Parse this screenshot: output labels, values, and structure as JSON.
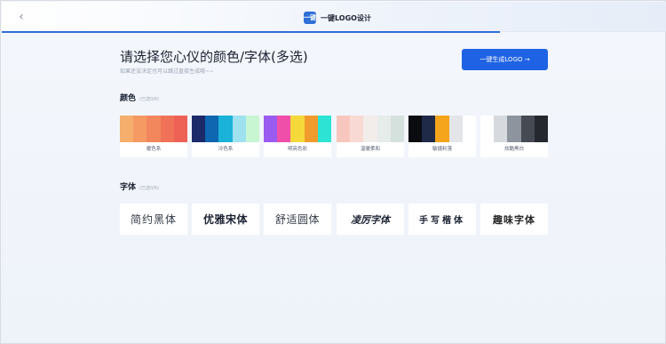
{
  "header": {
    "back_icon": "chevron-left-icon",
    "brand_logo_text": "一键",
    "brand_title": "一键LOGO设计",
    "progress_fraction": 0.75
  },
  "main": {
    "title": "请选择您心仪的颜色/字体(多选)",
    "subtitle": "如果还没决定也可以跳过直接生成哦~~",
    "generate_label": "一键生成LOGO →",
    "accent_color": "#1f63e4"
  },
  "colors_section": {
    "title": "颜色",
    "hint": "(已选0/6)",
    "options": [
      {
        "name": "暖色系",
        "swatches": [
          "#f6ae6c",
          "#f59a63",
          "#f2865c",
          "#f07359",
          "#ee6256"
        ]
      },
      {
        "name": "冷色系",
        "swatches": [
          "#1c2a6a",
          "#0f66b1",
          "#1ab2d8",
          "#9ee2f0",
          "#c8f5d2"
        ]
      },
      {
        "name": "明亮色彩",
        "swatches": [
          "#9a5cf0",
          "#ef4fa8",
          "#f5d83a",
          "#f19b2c",
          "#2de3d3"
        ]
      },
      {
        "name": "温暖柔和",
        "swatches": [
          "#f7c7bf",
          "#f9d9d3",
          "#f2ecea",
          "#e6ece9",
          "#d4e1dc"
        ]
      },
      {
        "name": "敏捷利落",
        "swatches": [
          "#0b0c10",
          "#1f2a48",
          "#f4a51c",
          "#e3e5e8",
          "#ffffff"
        ]
      },
      {
        "name": "炫酷黑白",
        "swatches": [
          "#ffffff",
          "#d6d9de",
          "#8e949e",
          "#454a53",
          "#25282e"
        ]
      }
    ]
  },
  "fonts_section": {
    "title": "字体",
    "hint": "(已选0/6)",
    "options": [
      {
        "name": "简约黑体"
      },
      {
        "name": "优雅宋体"
      },
      {
        "name": "舒适圆体"
      },
      {
        "name": "凌厉字体"
      },
      {
        "name": "手写楷体"
      },
      {
        "name": "趣味字体"
      }
    ]
  }
}
